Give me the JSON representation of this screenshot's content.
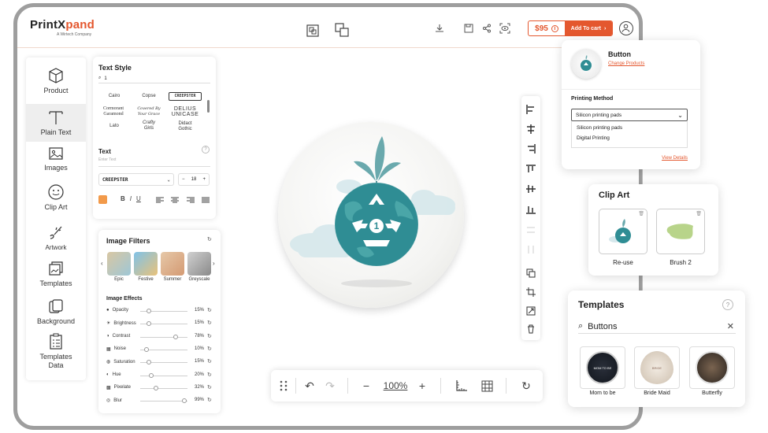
{
  "brand": {
    "name_part1": "PrintX",
    "name_part2": "pand",
    "tagline": "A Wirtech Company",
    "accent": "#e4572e"
  },
  "header": {
    "price": "$95",
    "add_to_cart": "Add To cart"
  },
  "leftnav": {
    "items": [
      {
        "label": "Product",
        "icon": "cube-icon"
      },
      {
        "label": "Plain Text",
        "icon": "text-icon"
      },
      {
        "label": "Images",
        "icon": "image-icon"
      },
      {
        "label": "Clip Art",
        "icon": "smiley-icon"
      },
      {
        "label": "Artwork",
        "icon": "paint-icon"
      },
      {
        "label": "Templates",
        "icon": "templates-icon"
      },
      {
        "label": "Background",
        "icon": "layers-icon"
      },
      {
        "label": "Templates\nData",
        "icon": "clipboard-icon"
      }
    ]
  },
  "text_style": {
    "title": "Text Style",
    "search_value": "1",
    "fonts": [
      "Cairo",
      "Copse",
      "CREEPSTER",
      "Cormorant\nGaramond",
      "Covered By\nYour Grace",
      "DELIUS\nUNICASE",
      "Lato",
      "Crafty\nGirls",
      "Didact\nGothic"
    ],
    "text_label": "Text",
    "text_placeholder": "Enter Text",
    "font_select": "CREEPSTER",
    "font_size": "18"
  },
  "image_filters": {
    "title": "Image Filters",
    "filters": [
      "Epic",
      "Festive",
      "Summer",
      "Greyscale"
    ],
    "effects_title": "Image Effects",
    "effects": [
      {
        "label": "Opacity",
        "value": "15%",
        "level": 0.15
      },
      {
        "label": "Brightness",
        "value": "15%",
        "level": 0.15
      },
      {
        "label": "Contrast",
        "value": "78%",
        "level": 0.78
      },
      {
        "label": "Noise",
        "value": "10%",
        "level": 0.1
      },
      {
        "label": "Saturation",
        "value": "15%",
        "level": 0.15
      },
      {
        "label": "Hue",
        "value": "20%",
        "level": 0.2
      },
      {
        "label": "Pixelate",
        "value": "32%",
        "level": 0.32
      },
      {
        "label": "Blur",
        "value": "99%",
        "level": 0.99
      }
    ]
  },
  "canvas": {
    "badge_number": "1"
  },
  "zoom": {
    "level": "100%"
  },
  "product_card": {
    "title": "Button",
    "change_link": "Change Products",
    "method_label": "Printing Method",
    "selected": "Silicon printing pads",
    "options": [
      "Silicon printing pads",
      "Digital Printing"
    ],
    "view_details": "View Details"
  },
  "clipart": {
    "title": "Clip Art",
    "items": [
      "Re-use",
      "Brush 2"
    ]
  },
  "templates": {
    "title": "Templates",
    "search_value": "Buttons",
    "items": [
      "Mom to be",
      "Bride Maid",
      "Butterfly"
    ],
    "thumb_text_1": "MOM TO BE",
    "thumb_text_2": "BRIDE"
  }
}
